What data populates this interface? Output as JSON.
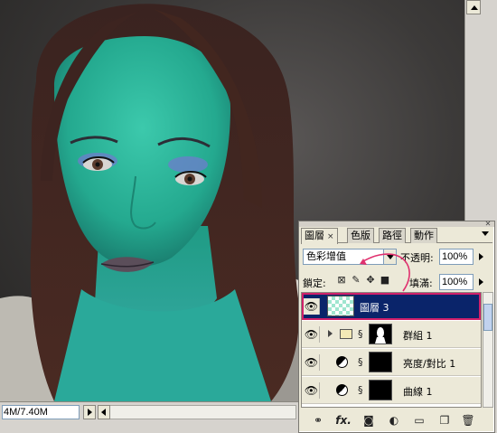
{
  "status_bar": {
    "doc_size": "4M/7.40M"
  },
  "layers_panel": {
    "tabs": [
      {
        "label": "圖層",
        "close": "×",
        "active": true
      },
      {
        "label": "色版",
        "active": false
      },
      {
        "label": "路徑",
        "active": false
      },
      {
        "label": "動作",
        "active": false
      }
    ],
    "blend_mode": "色彩增值",
    "opacity_label": "不透明:",
    "opacity_value": "100%",
    "lock_label": "鎖定:",
    "fill_label": "填滿:",
    "fill_value": "100%",
    "layers": [
      {
        "name": "圖層 3",
        "kind": "pixel",
        "selected": true,
        "visible": true
      },
      {
        "name": "群組 1",
        "kind": "group",
        "selected": false,
        "visible": true
      },
      {
        "name": "亮度/對比 1",
        "kind": "adjustment",
        "selected": false,
        "visible": true
      },
      {
        "name": "曲線 1",
        "kind": "adjustment",
        "selected": false,
        "visible": true
      }
    ],
    "bottom_icons": [
      "link-icon",
      "fx-icon",
      "mask-icon",
      "adjustment-icon",
      "folder-icon",
      "new-layer-icon",
      "trash-icon"
    ],
    "bottom_fx": "fx."
  },
  "colors": {
    "skin_tint": "#2fb8a0",
    "selection": "#0a246a",
    "annotation": "#e0306e"
  }
}
